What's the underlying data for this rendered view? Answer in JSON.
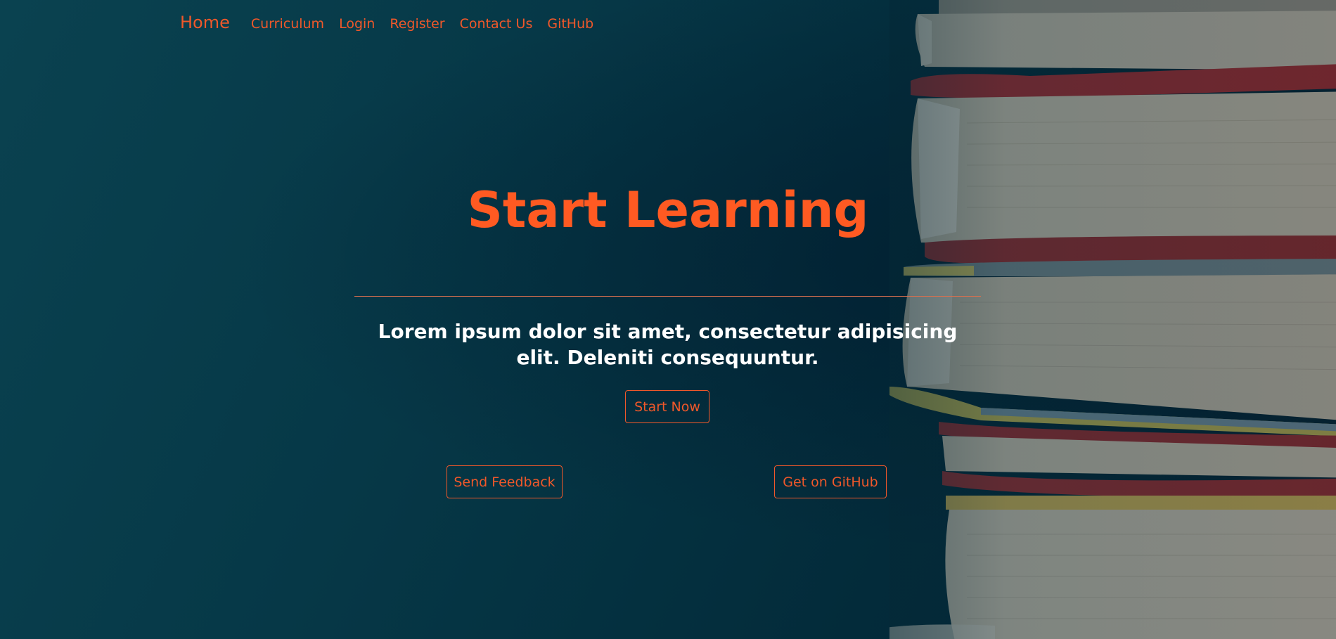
{
  "nav": {
    "brand": "Home",
    "links": [
      "Curriculum",
      "Login",
      "Register",
      "Contact Us",
      "GitHub"
    ]
  },
  "hero": {
    "title": "Start Learning",
    "lead": "Lorem ipsum dolor sit amet, consectetur adipisicing elit. Deleniti consequuntur.",
    "start_button": "Start Now",
    "feedback_button": "Send Feedback",
    "github_button": "Get on GitHub"
  },
  "colors": {
    "accent": "#f0582a",
    "title": "#ff5a22",
    "background": "#063847",
    "text": "#ffffff"
  },
  "icons": {
    "background_image": "book-stack-image"
  }
}
